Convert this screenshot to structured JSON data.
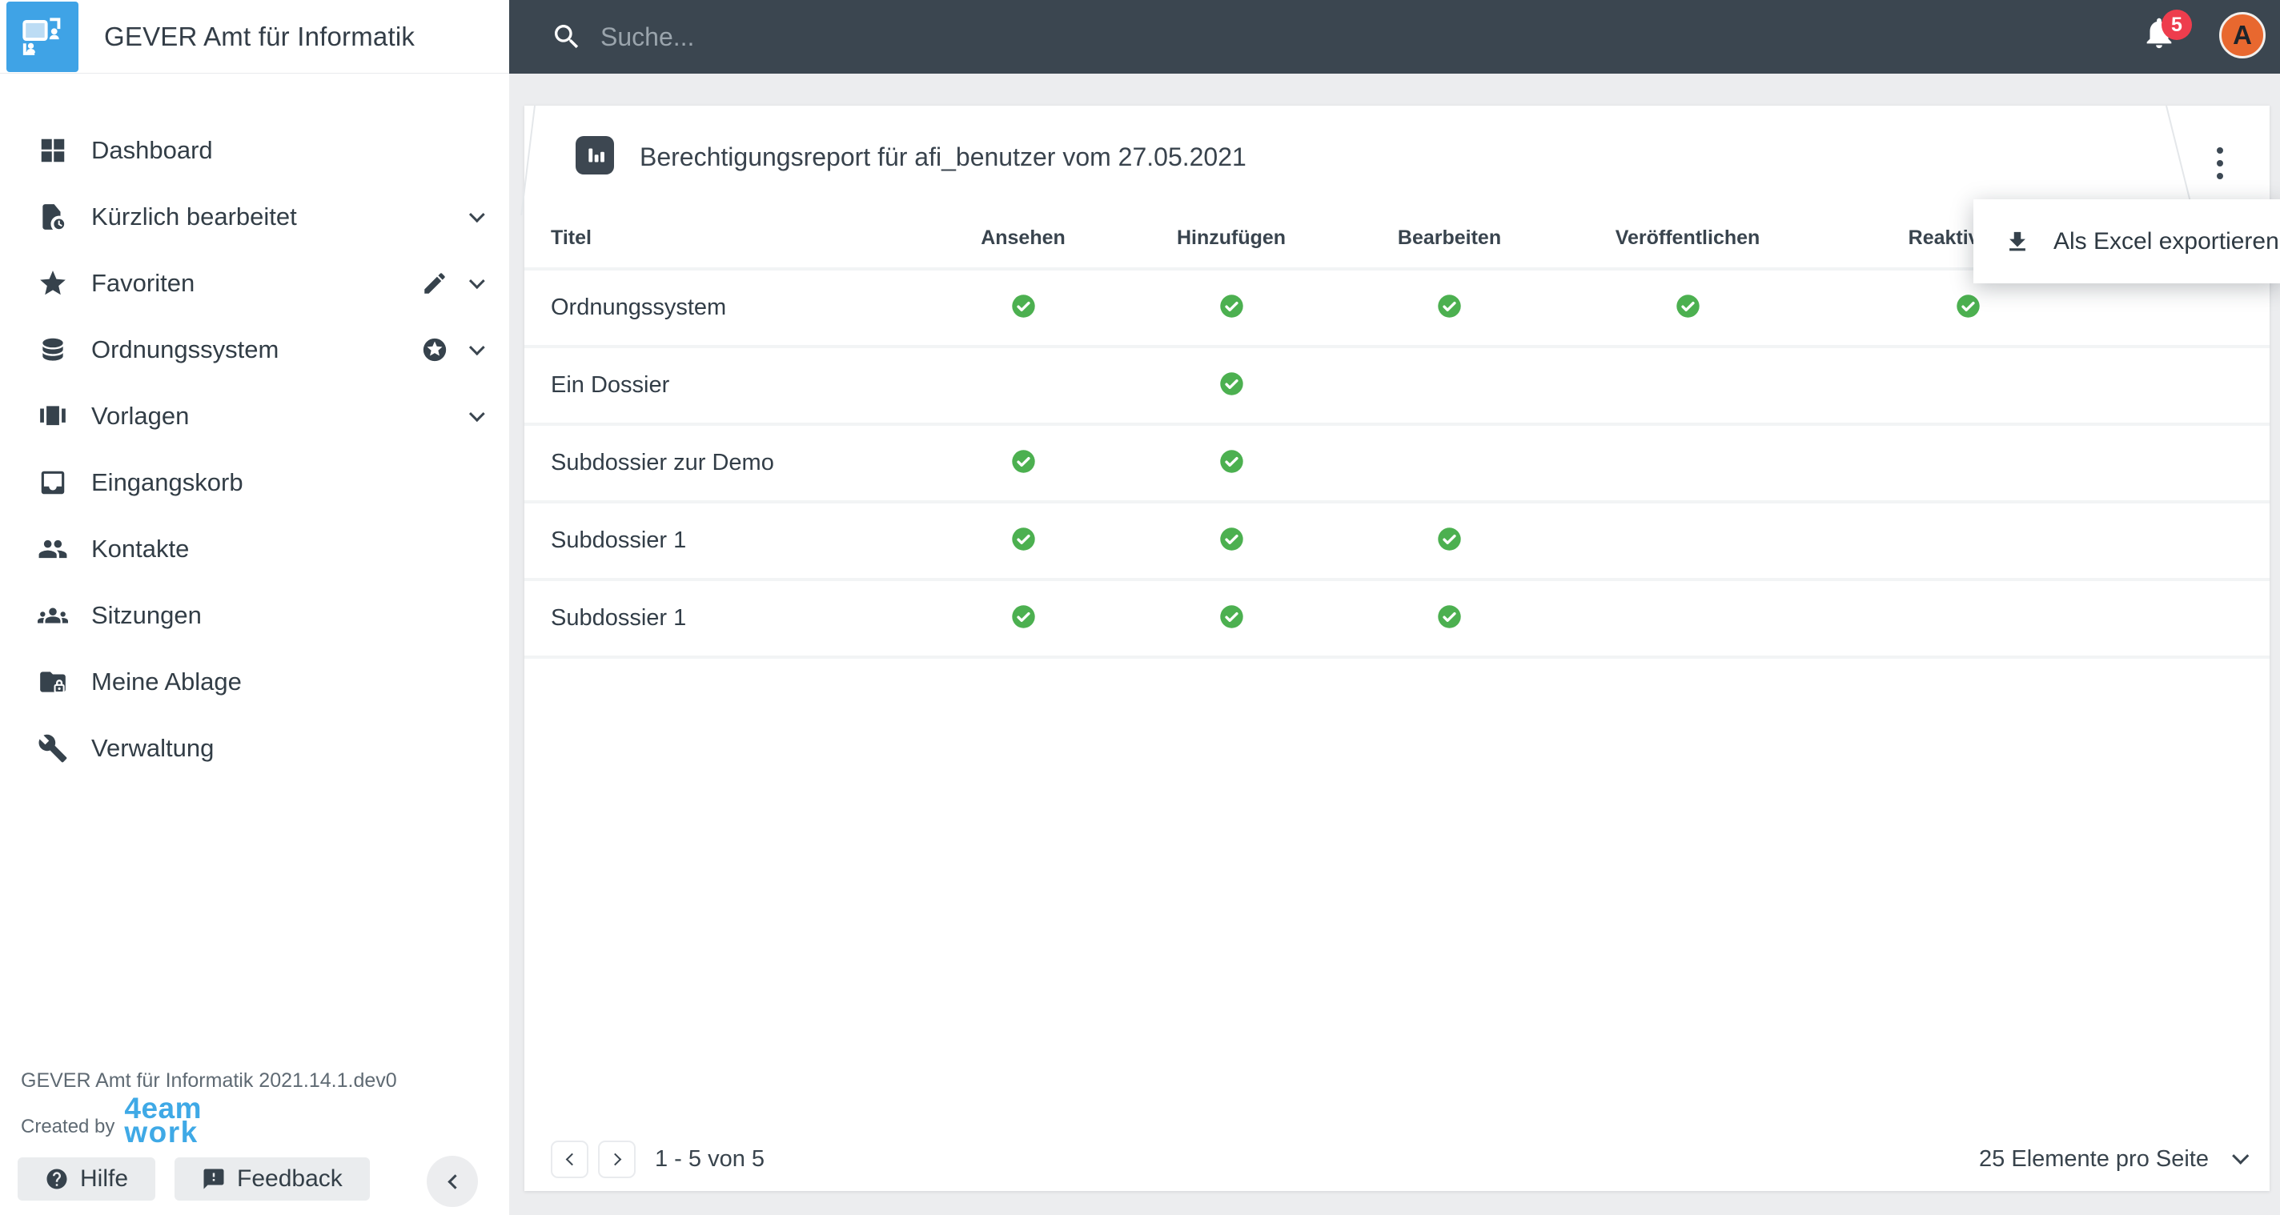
{
  "app": {
    "title": "GEVER Amt für Informatik"
  },
  "topbar": {
    "search_placeholder": "Suche...",
    "notification_count": "5",
    "avatar_letter": "A"
  },
  "sidebar": {
    "items": [
      {
        "id": "dashboard",
        "label": "Dashboard",
        "icon": "dashboard-icon",
        "chevron": false,
        "edit": false,
        "badge_star": false
      },
      {
        "id": "recent",
        "label": "Kürzlich bearbeitet",
        "icon": "recent-icon",
        "chevron": true,
        "edit": false,
        "badge_star": false
      },
      {
        "id": "favorites",
        "label": "Favoriten",
        "icon": "star-icon",
        "chevron": true,
        "edit": true,
        "badge_star": false
      },
      {
        "id": "ordnungssystem",
        "label": "Ordnungssystem",
        "icon": "database-icon",
        "chevron": true,
        "edit": false,
        "badge_star": true
      },
      {
        "id": "vorlagen",
        "label": "Vorlagen",
        "icon": "templates-icon",
        "chevron": true,
        "edit": false,
        "badge_star": false
      },
      {
        "id": "eingangskorb",
        "label": "Eingangskorb",
        "icon": "inbox-icon",
        "chevron": false,
        "edit": false,
        "badge_star": false
      },
      {
        "id": "kontakte",
        "label": "Kontakte",
        "icon": "contacts-icon",
        "chevron": false,
        "edit": false,
        "badge_star": false
      },
      {
        "id": "sitzungen",
        "label": "Sitzungen",
        "icon": "meetings-icon",
        "chevron": false,
        "edit": false,
        "badge_star": false
      },
      {
        "id": "meine-ablage",
        "label": "Meine Ablage",
        "icon": "folder-lock-icon",
        "chevron": false,
        "edit": false,
        "badge_star": false
      },
      {
        "id": "verwaltung",
        "label": "Verwaltung",
        "icon": "wrench-icon",
        "chevron": false,
        "edit": false,
        "badge_star": false
      }
    ],
    "footer": {
      "version": "GEVER Amt für Informatik 2021.14.1.dev0",
      "created_by": "Created by",
      "logo_line1": "4eam",
      "logo_line2": "work",
      "help_label": "Hilfe",
      "feedback_label": "Feedback"
    }
  },
  "report": {
    "title": "Berechtigungsreport für afi_benutzer vom 27.05.2021",
    "menu": {
      "export_label": "Als Excel exportieren"
    },
    "table": {
      "columns": [
        "Titel",
        "Ansehen",
        "Hinzufügen",
        "Bearbeiten",
        "Veröffentlichen",
        "Reaktivieren"
      ],
      "rows": [
        {
          "title": "Ordnungssystem",
          "permissions": [
            true,
            true,
            true,
            true,
            true
          ]
        },
        {
          "title": "Ein Dossier",
          "permissions": [
            false,
            true,
            false,
            false,
            false
          ]
        },
        {
          "title": "Subdossier zur Demo",
          "permissions": [
            true,
            true,
            false,
            false,
            false
          ]
        },
        {
          "title": "Subdossier 1",
          "permissions": [
            true,
            true,
            true,
            false,
            false
          ]
        },
        {
          "title": "Subdossier 1",
          "permissions": [
            true,
            true,
            true,
            false,
            false
          ]
        }
      ]
    },
    "pagination": {
      "range_text": "1 - 5 von 5",
      "per_page_text": "25 Elemente pro Seite"
    }
  },
  "colors": {
    "topbar": "#3b4650",
    "brand_blue": "#3fa3e6",
    "logo_blue": "#3fa9e6",
    "check_green": "#4cb050",
    "badge_red": "#ee3d4d",
    "avatar_orange": "#e8682f"
  }
}
